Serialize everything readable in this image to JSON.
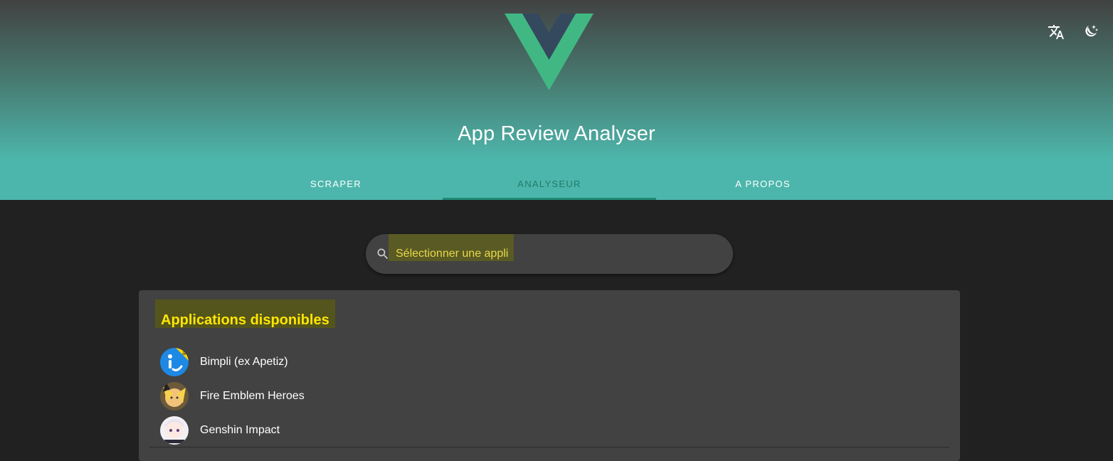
{
  "header": {
    "title": "App Review Analyser",
    "logo_icon": "vue-logo-icon",
    "icons": [
      {
        "name": "translate-icon"
      },
      {
        "name": "dark-mode-icon"
      }
    ]
  },
  "tabs": [
    {
      "label": "Scraper",
      "active": false
    },
    {
      "label": "Analyseur",
      "active": true
    },
    {
      "label": "A propos",
      "active": false
    }
  ],
  "search": {
    "placeholder": "Sélectionner une appli",
    "icon": "search-icon"
  },
  "apps_card": {
    "title": "Applications disponibles",
    "items": [
      {
        "label": "Bimpli (ex Apetiz)",
        "icon": "bimpli-app-icon"
      },
      {
        "label": "Fire Emblem Heroes",
        "icon": "fire-emblem-app-icon"
      },
      {
        "label": "Genshin Impact",
        "icon": "genshin-app-icon"
      }
    ]
  },
  "colors": {
    "accent": "#4db6ac",
    "active_tab": "#1f8a78",
    "highlight_text": "#ffe600"
  }
}
